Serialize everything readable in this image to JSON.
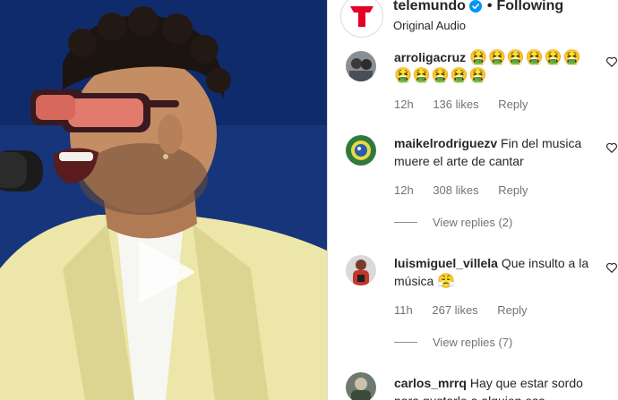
{
  "header": {
    "account_name": "telemundo",
    "separator": "•",
    "follow_status": "Following",
    "audio_label": "Original Audio"
  },
  "comments": [
    {
      "username": "arroligacruz",
      "text": "",
      "emoji": "🤮🤮🤮🤮🤮🤮🤮🤮🤮🤮🤮",
      "time": "12h",
      "likes": "136 likes",
      "reply_label": "Reply"
    },
    {
      "username": "maikelrodriguezv",
      "text": "Fin del musica muere el arte de cantar",
      "time": "12h",
      "likes": "308 likes",
      "reply_label": "Reply",
      "view_replies": "View replies (2)"
    },
    {
      "username": "luismiguel_villela",
      "text": "Que insulto a la música",
      "emoji": "😤",
      "time": "11h",
      "likes": "267 likes",
      "reply_label": "Reply",
      "view_replies": "View replies (7)"
    },
    {
      "username": "carlos_mrrq",
      "text": "Hay que estar sordo para gustarle a alguien esa"
    }
  ],
  "colors": {
    "verified": "#0095f6",
    "brand_red": "#e4002b",
    "secondary_text": "#737373"
  },
  "icons": {
    "play": "play-icon",
    "verified": "verified-badge-icon",
    "heart": "heart-outline-icon"
  }
}
